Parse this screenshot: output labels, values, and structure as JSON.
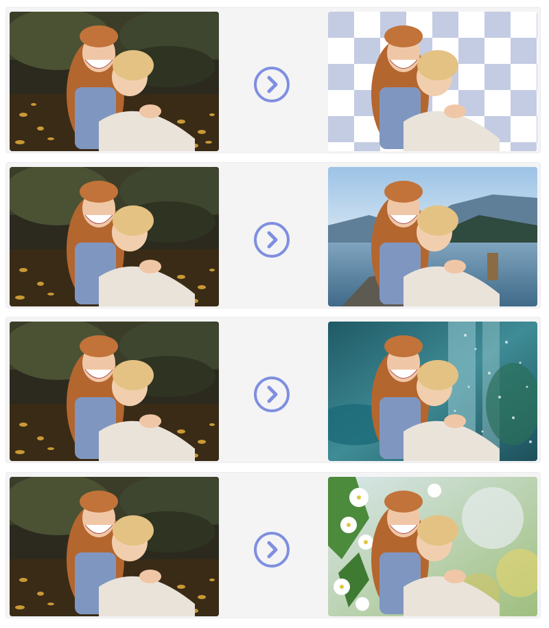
{
  "rows": [
    {
      "source_image": "photo-original-girls-hugging",
      "action_icon": "chevron-right-icon",
      "result_image": "photo-background-removed-transparent"
    },
    {
      "source_image": "photo-original-girls-hugging",
      "action_icon": "chevron-right-icon",
      "result_image": "photo-background-lake-mountains"
    },
    {
      "source_image": "photo-original-girls-hugging",
      "action_icon": "chevron-right-icon",
      "result_image": "photo-background-rainy-teal"
    },
    {
      "source_image": "photo-original-girls-hugging",
      "action_icon": "chevron-right-icon",
      "result_image": "photo-background-white-flowers"
    }
  ],
  "colors": {
    "row_background": "#f4f4f5",
    "arrow_accent": "#7f8fe0",
    "checker_dark": "#c4cce3",
    "checker_light": "#ffffff"
  }
}
